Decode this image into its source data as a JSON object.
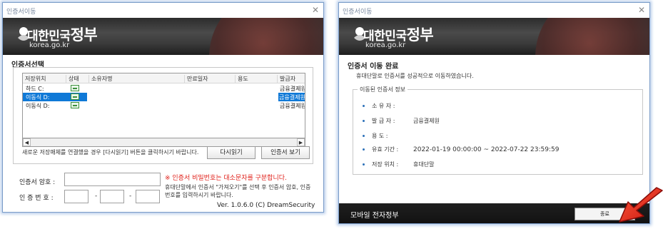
{
  "dialog1": {
    "title": "인증서이동",
    "brand": {
      "pre": "대한민국",
      "big": "정부",
      "url": "korea.go.kr"
    },
    "section_title": "인증서선택",
    "columns": [
      "저장위치",
      "상태",
      "소유자명",
      "만료일자",
      "용도",
      "발급자"
    ],
    "rows": [
      {
        "location": "하드 C:",
        "issuer": "금융결제원",
        "selected": false
      },
      {
        "location": "이동식 D:",
        "issuer": "금융결제원",
        "selected": true
      },
      {
        "location": "이동식 D:",
        "issuer": "금융결제원",
        "selected": false
      }
    ],
    "hint": "새로운 저장매체를 연결했을 경우 [다시읽기] 버튼을 클릭하시기 바랍니다.",
    "reload_button": "다시읽기",
    "view_button": "인증서 보기",
    "password_label": "인증서 암호 :",
    "auth_label": "인 증 번 호 :",
    "dash": "-",
    "warning": "※ 인증서 비밀번호는 대소문자를 구분합니다.",
    "info": "휴대단말에서 인증서 \"가져오기\"를 선택 후 인증서 암호, 인증번호를 입력하시기 바랍니다.",
    "version": "Ver. 1.0.6.0  (C) DreamSecurity"
  },
  "dialog2": {
    "title": "인증서이동",
    "brand": {
      "pre": "대한민국",
      "big": "정부",
      "url": "korea.go.kr"
    },
    "done_title": "인증서 이동 완료",
    "done_message": "휴대단말로 인증서를 성공적으로 이동하였습니다.",
    "group_title": "이동된 인증서 정보",
    "fields": [
      {
        "key": "소  유  자 :",
        "value": ""
      },
      {
        "key": "발  급  자 :",
        "value": "금융결제원"
      },
      {
        "key": "용        도 :",
        "value": ""
      },
      {
        "key": "유효 기간 :",
        "value": "2022-01-19 00:00:00 ~ 2022-07-22 23:59:59"
      },
      {
        "key": "저장 위치 :",
        "value": "휴대단말"
      }
    ],
    "footer_text": "모바일 전자정부",
    "close_button": "종료"
  },
  "colors": {
    "selection": "#0f79d7",
    "warning": "#e0201a",
    "pointer_arrow": "#e02418"
  },
  "icons": [
    "close-icon",
    "emblem-icon",
    "certificate-icon",
    "scroll-left-icon",
    "scroll-right-icon",
    "red-pointer-arrow-icon"
  ]
}
